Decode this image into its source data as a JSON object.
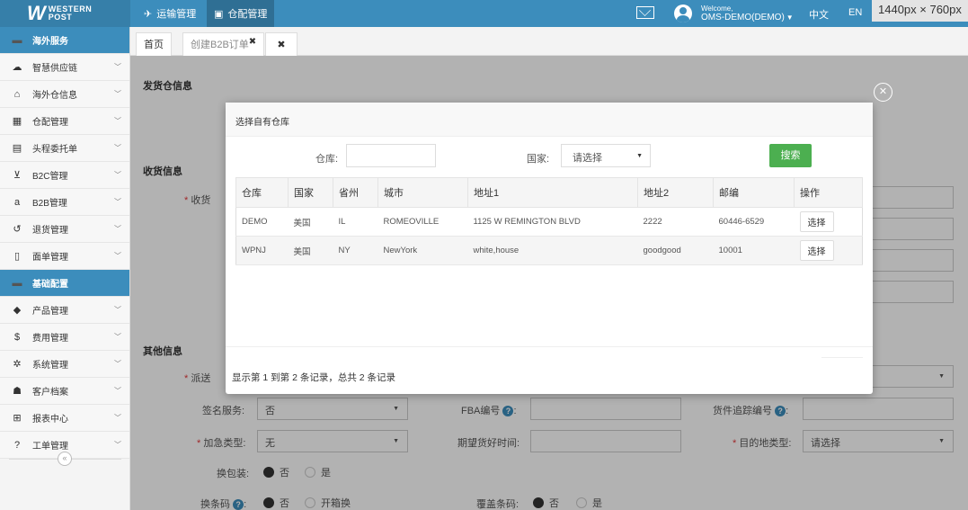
{
  "app": {
    "logo_line1": "WESTERN",
    "logo_line2": "POST",
    "nav": [
      "运输管理",
      "仓配管理"
    ],
    "welcome": "Welcome,",
    "account": "OMS-DEMO(DEMO)",
    "lang_zh": "中文",
    "lang_en": "EN",
    "size_tip": "1440px × 760px"
  },
  "sidebar": {
    "items": [
      {
        "label": "海外服务",
        "icon": "folder-icon",
        "section": true
      },
      {
        "label": "智慧供应链",
        "icon": "cloud-icon"
      },
      {
        "label": "海外仓信息",
        "icon": "home-icon"
      },
      {
        "label": "仓配管理",
        "icon": "grid-icon"
      },
      {
        "label": "头程委托单",
        "icon": "briefcase-icon"
      },
      {
        "label": "B2C管理",
        "icon": "cart-icon"
      },
      {
        "label": "B2B管理",
        "icon": "amazon-icon"
      },
      {
        "label": "退货管理",
        "icon": "return-icon"
      },
      {
        "label": "面单管理",
        "icon": "file-icon"
      },
      {
        "label": "基础配置",
        "icon": "folder-icon",
        "section": true
      },
      {
        "label": "产品管理",
        "icon": "tag-icon"
      },
      {
        "label": "费用管理",
        "icon": "dollar-icon"
      },
      {
        "label": "系统管理",
        "icon": "gear-icon"
      },
      {
        "label": "客户档案",
        "icon": "users-icon"
      },
      {
        "label": "报表中心",
        "icon": "table-icon"
      },
      {
        "label": "工单管理",
        "icon": "question-icon"
      }
    ]
  },
  "tabs": {
    "home": "首页",
    "create": "创建B2B订单"
  },
  "form": {
    "ship_section": "发货仓信息",
    "recv_section": "收货信息",
    "other_section": "其他信息",
    "recv_label": "收货",
    "dispatch_label": "派送",
    "sign_label": "签名服务:",
    "sign_value": "否",
    "fba_label": "FBA编号",
    "tracking_label": "货件追踪编号",
    "urgent_label": "加急类型:",
    "urgent_value": "无",
    "expect_label": "期望货好时间:",
    "dest_label": "目的地类型:",
    "dest_value": "请选择",
    "repack_label": "换包装:",
    "opt_no": "否",
    "opt_yes": "是",
    "barcode_label": "换条码",
    "opt_open": "开箱换",
    "cover_label": "覆盖条码:"
  },
  "modal": {
    "title": "选择自有仓库",
    "warehouse_label": "仓库:",
    "country_label": "国家:",
    "country_value": "请选择",
    "search_button": "搜索",
    "columns": [
      "仓库",
      "国家",
      "省州",
      "城市",
      "地址1",
      "地址2",
      "邮编",
      "操作"
    ],
    "rows": [
      {
        "warehouse": "DEMO",
        "country": "美国",
        "state": "IL",
        "city": "ROMEOVILLE",
        "address1": "1125 W REMINGTON BLVD",
        "address2": "2222",
        "zip": "60446-6529",
        "action": "选择"
      },
      {
        "warehouse": "WPNJ",
        "country": "美国",
        "state": "NY",
        "city": "NewYork",
        "address1": "white,house",
        "address2": "goodgood",
        "zip": "10001",
        "action": "选择"
      }
    ],
    "pager": "显示第 1 到第 2 条记录，总共 2 条记录"
  }
}
